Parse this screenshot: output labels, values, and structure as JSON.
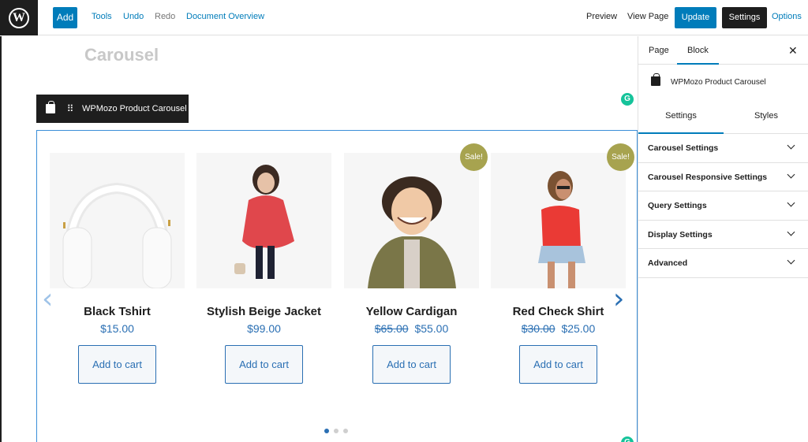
{
  "topbar": {
    "add_label": "Add",
    "tools_label": "Tools",
    "undo_label": "Undo",
    "redo_label": "Redo",
    "document_overview_label": "Document Overview",
    "preview_label": "Preview",
    "view_page_label": "View Page",
    "update_label": "Update",
    "settings_label": "Settings",
    "options_label": "Options"
  },
  "canvas": {
    "faded_title": "Carousel",
    "block_toolbar_label": "WPMozo Product Carousel"
  },
  "carousel": {
    "sale_label": "Sale!",
    "add_to_cart_label": "Add to cart",
    "products": [
      {
        "name": "Black Tshirt",
        "price": "$15.00",
        "old_price": "",
        "sale": false
      },
      {
        "name": "Stylish Beige Jacket",
        "price": "$99.00",
        "old_price": "",
        "sale": false
      },
      {
        "name": "Yellow Cardigan",
        "price": "$55.00",
        "old_price": "$65.00",
        "sale": true
      },
      {
        "name": "Red Check Shirt",
        "price": "$25.00",
        "old_price": "$30.00",
        "sale": true
      }
    ],
    "dots_total": 3,
    "dots_active": 1
  },
  "sidebar": {
    "tab_page": "Page",
    "tab_block": "Block",
    "block_title": "WPMozo Product Carousel",
    "subtab_settings": "Settings",
    "subtab_styles": "Styles",
    "panels": [
      "Carousel Settings",
      "Carousel Responsive Settings",
      "Query Settings",
      "Display Settings",
      "Advanced"
    ]
  },
  "colors": {
    "accent": "#007cba",
    "sale_badge": "#a7a34f",
    "dark": "#1e1e1e"
  }
}
